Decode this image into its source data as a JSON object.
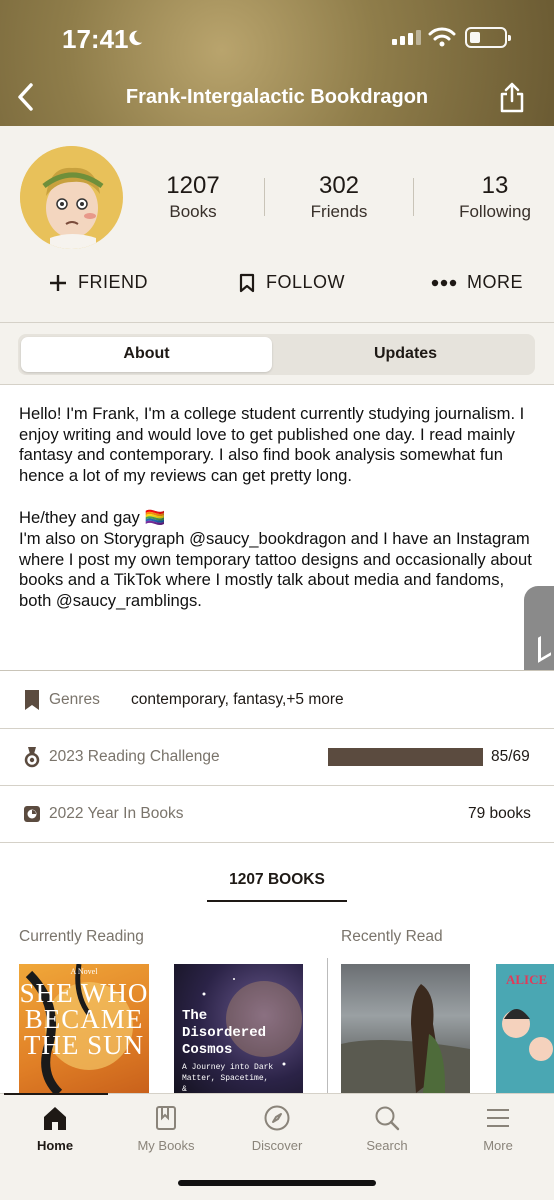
{
  "status_bar": {
    "time": "17:41"
  },
  "header": {
    "title": "Frank-Intergalactic Bookdragon",
    "back_icon": "chevron-left-icon",
    "share_icon": "share-icon"
  },
  "profile": {
    "stats": [
      {
        "value": "1207",
        "label": "Books"
      },
      {
        "value": "302",
        "label": "Friends"
      },
      {
        "value": "13",
        "label": "Following"
      }
    ],
    "actions": [
      {
        "label": "FRIEND",
        "icon": "plus-icon"
      },
      {
        "label": "FOLLOW",
        "icon": "bookmark-icon"
      },
      {
        "label": "MORE",
        "icon": "more-icon"
      }
    ]
  },
  "tabs": {
    "about": "About",
    "updates": "Updates",
    "selected": "About"
  },
  "about": {
    "paragraphs": [
      "Hello! I'm Frank, I'm a college student currently studying journalism. I enjoy writing and would love to get published one day. I read mainly fantasy and contemporary. I also find book analysis somewhat fun hence a lot of my reviews can get pretty long.",
      "He/they and gay 🏳️‍🌈",
      "I'm also on Storygraph @saucy_bookdragon and I have an Instagram where I post my own temporary tattoo designs and occasionally about books and a TikTok where I mostly talk about media and fandoms, both @saucy_ramblings."
    ]
  },
  "info_rows": {
    "genres": {
      "label": "Genres",
      "value": "contemporary, fantasy,+5 more"
    },
    "challenge": {
      "label": "2023 Reading Challenge",
      "value": "85/69",
      "progress": 1.0
    },
    "year_in_books": {
      "label": "2022 Year In Books",
      "value": "79 books"
    }
  },
  "books": {
    "tab_label": "1207 BOOKS",
    "currently_reading": "Currently Reading",
    "recently_read": "Recently Read",
    "covers": [
      {
        "title": "SHE WHO BECAME THE SUN",
        "small": "A Novel"
      },
      {
        "title": "The Disordered Cosmos",
        "small": "A Journey into Dark Matter, Spacetime, &"
      },
      {
        "title": ""
      },
      {
        "title": "ALICE"
      }
    ]
  },
  "tabbar": {
    "items": [
      {
        "label": "Home",
        "icon": "home-icon"
      },
      {
        "label": "My Books",
        "icon": "my-books-icon"
      },
      {
        "label": "Discover",
        "icon": "compass-icon"
      },
      {
        "label": "Search",
        "icon": "search-icon"
      },
      {
        "label": "More",
        "icon": "menu-icon"
      }
    ],
    "active": "Home"
  },
  "colors": {
    "accent": "#1e1915",
    "progress_fill": "#5b4b3f",
    "header_bg": "#8f7d4a",
    "background": "#f4f2ed"
  }
}
